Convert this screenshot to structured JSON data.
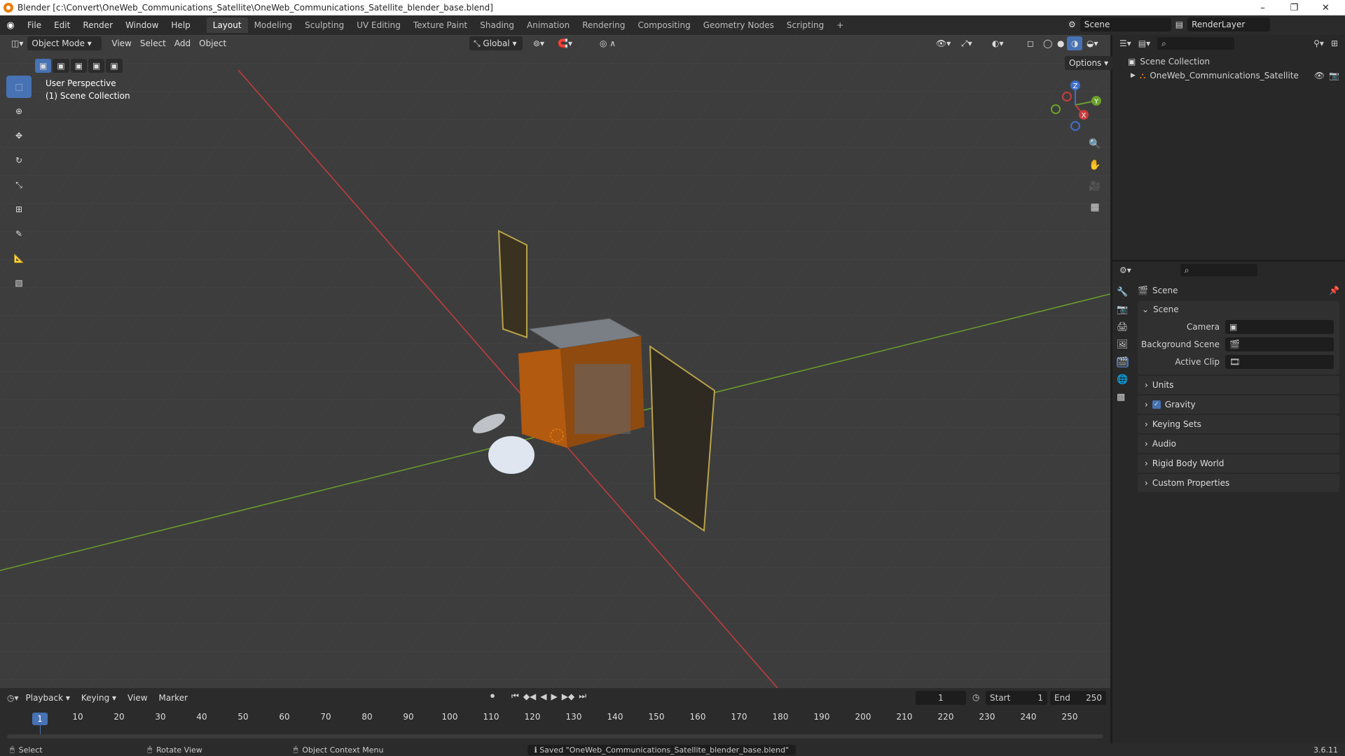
{
  "titlebar": {
    "title": "Blender [c:\\Convert\\OneWeb_Communications_Satellite\\OneWeb_Communications_Satellite_blender_base.blend]",
    "minimize": "–",
    "maximize": "❐",
    "close": "✕"
  },
  "menu": {
    "items": [
      "File",
      "Edit",
      "Render",
      "Window",
      "Help"
    ],
    "workspaces": [
      "Layout",
      "Modeling",
      "Sculpting",
      "UV Editing",
      "Texture Paint",
      "Shading",
      "Animation",
      "Rendering",
      "Compositing",
      "Geometry Nodes",
      "Scripting"
    ],
    "add_workspace": "+",
    "scene_name": "Scene",
    "view_layer": "RenderLayer"
  },
  "viewport": {
    "mode": "Object Mode",
    "menus": [
      "View",
      "Select",
      "Add",
      "Object"
    ],
    "orientation": "Global",
    "options": "Options",
    "overlay_title": "User Perspective",
    "overlay_collection": "(1) Scene Collection",
    "gizmo": {
      "x": "X",
      "y": "Y",
      "z": "Z"
    }
  },
  "outliner": {
    "root": "Scene Collection",
    "object": "OneWeb_Communications_Satellite"
  },
  "properties": {
    "header": "Scene",
    "panel_scene": "Scene",
    "camera_label": "Camera",
    "background_label": "Background Scene",
    "clip_label": "Active Clip",
    "panels": [
      "Units",
      "Gravity",
      "Keying Sets",
      "Audio",
      "Rigid Body World",
      "Custom Properties"
    ]
  },
  "timeline": {
    "menus": [
      "Playback",
      "Keying",
      "View",
      "Marker"
    ],
    "current_frame": "1",
    "start_label": "Start",
    "start": "1",
    "end_label": "End",
    "end": "250",
    "ticks": [
      "10",
      "20",
      "30",
      "40",
      "50",
      "60",
      "70",
      "80",
      "90",
      "100",
      "110",
      "120",
      "130",
      "140",
      "150",
      "160",
      "170",
      "180",
      "190",
      "200",
      "210",
      "220",
      "230",
      "240",
      "250"
    ]
  },
  "status": {
    "select": "Select",
    "rotate": "Rotate View",
    "context": "Object Context Menu",
    "message": "Saved \"OneWeb_Communications_Satellite_blender_base.blend\"",
    "version": "3.6.11"
  },
  "colors": {
    "accent": "#4772b3",
    "x_axis": "#c83c3c",
    "y_axis": "#6aa02c",
    "z_axis": "#3f6fc8",
    "orange": "#e87d0d"
  }
}
